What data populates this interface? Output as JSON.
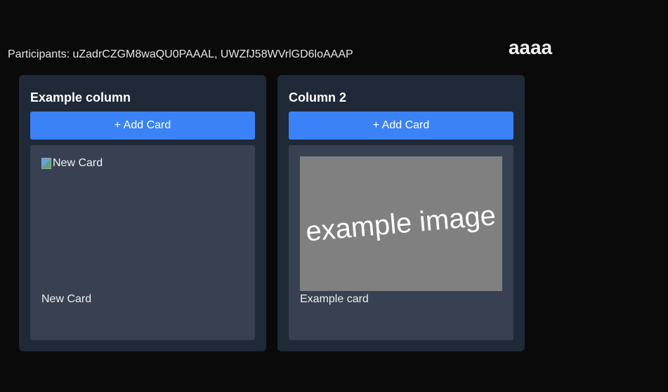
{
  "board": {
    "title": "aaaa",
    "participants": "Participants: uZadrCZGM8waQU0PAAAL, UWZfJ58WVrlGD6loAAAP"
  },
  "columns": [
    {
      "title": "Example column",
      "add_label": "+ Add Card",
      "cards": [
        {
          "image_alt": "New Card",
          "image_broken": true,
          "label": "New Card"
        }
      ]
    },
    {
      "title": "Column 2",
      "add_label": "+ Add Card",
      "cards": [
        {
          "image_text": "example image",
          "label": "Example card"
        }
      ]
    }
  ],
  "colors": {
    "background": "#0a0a0a",
    "column": "#1f2937",
    "card": "#374151",
    "accent": "#3b82f6",
    "image_placeholder": "#808080"
  },
  "icons": {
    "broken_image": "broken-image-icon"
  }
}
